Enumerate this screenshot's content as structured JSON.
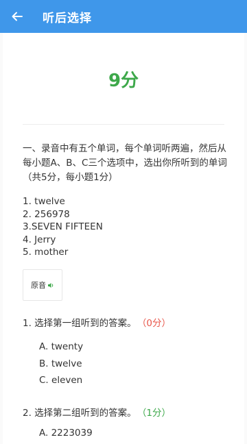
{
  "header": {
    "title": "听后选择",
    "back_icon": "arrow-left-icon",
    "bg_color": "#3f97ea"
  },
  "score": "9分",
  "instruction": "一、录音中有五个单词，每个单词听两遍，然后从每小题A、B、C三个选项中，选出你所听到的单词（共5分，每小题1分）",
  "items": [
    "1. twelve",
    "2. 256978",
    "3.SEVEN FIFTEEN",
    "4. Jerry",
    "5. mother"
  ],
  "audio": {
    "label": "原音",
    "icon": "speaker-icon"
  },
  "questions": [
    {
      "text": "1. 选择第一组听到的答案。",
      "points": "（0分）",
      "options": [
        "A. twenty",
        "B. twelve",
        "C. eleven"
      ]
    },
    {
      "text": "2. 选择第二组听到的答案。",
      "points": "（1分）",
      "options": [
        "A. 2223039"
      ]
    }
  ],
  "colors": {
    "correct": "#3da84a",
    "wrong": "#e8564a"
  }
}
